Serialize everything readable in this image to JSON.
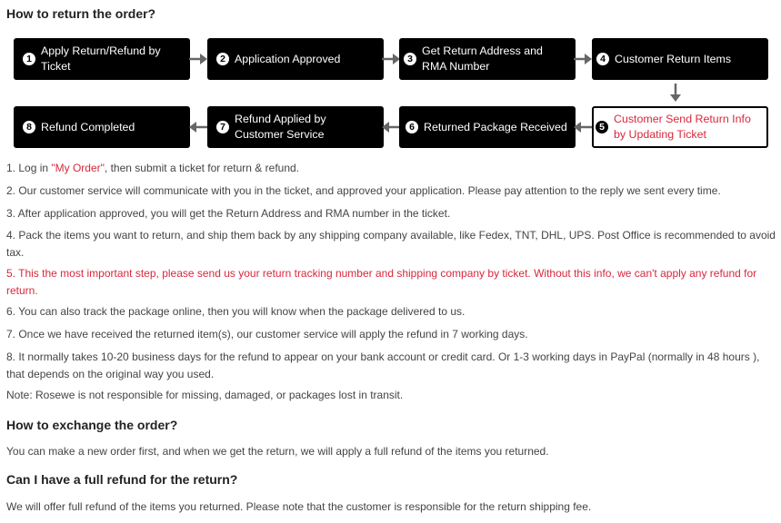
{
  "return_section": {
    "title": "How to return the order?",
    "steps": [
      {
        "num": "1",
        "label": "Apply Return/Refund by Ticket"
      },
      {
        "num": "2",
        "label": "Application Approved"
      },
      {
        "num": "3",
        "label": "Get Return Address and RMA Number"
      },
      {
        "num": "4",
        "label": "Customer Return Items"
      },
      {
        "num": "5",
        "label": "Customer Send Return Info by Updating Ticket",
        "highlighted": true
      },
      {
        "num": "6",
        "label": "Returned Package Received"
      },
      {
        "num": "7",
        "label": "Refund Applied by Customer Service"
      },
      {
        "num": "8",
        "label": "Refund Completed"
      }
    ],
    "instructions": [
      {
        "prefix": "1. Log in ",
        "link": "\"My Order\"",
        "suffix": ", then submit a ticket for return & refund."
      },
      {
        "text": "2. Our customer service will communicate with you in the ticket, and approved your application. Please pay attention to the reply we sent every time."
      },
      {
        "text": "3. After application approved, you will get the Return Address and RMA number in the ticket."
      },
      {
        "text": "4. Pack the items you want to return, and ship them back by any shipping company available, like Fedex, TNT, DHL, UPS. Post Office is recommended to avoid tax."
      },
      {
        "text": "5. This the most important step, please send us your return tracking number and shipping company by ticket. Without this info, we can't apply any refund for return.",
        "important": true
      },
      {
        "text": "6. You can also track the package online, then you will know when the package delivered to us."
      },
      {
        "text": "7. Once we have received the returned item(s), our customer service will apply the refund in 7 working days."
      },
      {
        "text": "8.  It normally takes 10-20 business days for the refund to appear on your bank account or credit card. Or 1-3 working days in PayPal (normally in 48 hours ), that depends on the original way you used."
      },
      {
        "text": "Note: Rosewe is not responsible for missing, damaged, or packages lost in transit."
      }
    ]
  },
  "exchange_section": {
    "title": "How to exchange the order?",
    "body": "You can make a new order first, and when we get the return, we will apply a full refund of the items you returned."
  },
  "refund_section": {
    "title": "Can I have a full refund for the return?",
    "body": "We will offer full refund of the items you returned. Please note that the customer is responsible for the return shipping fee."
  },
  "colors": {
    "accent_red": "#d7283c",
    "box_bg": "#000000",
    "arrow": "#666666",
    "text": "#444444"
  }
}
